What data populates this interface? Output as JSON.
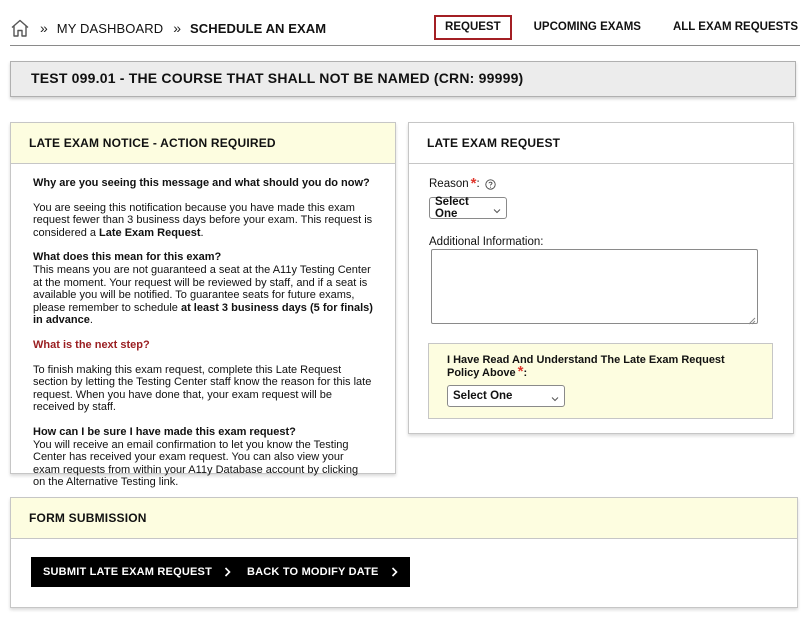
{
  "breadcrumb": {
    "sep": "»",
    "items": [
      "MY DASHBOARD",
      "SCHEDULE AN EXAM"
    ]
  },
  "nav": {
    "tabs": [
      {
        "label": "REQUEST",
        "active": true
      },
      {
        "label": "UPCOMING EXAMS",
        "active": false
      },
      {
        "label": "ALL EXAM REQUESTS",
        "active": false
      }
    ]
  },
  "course": {
    "title": "TEST 099.01 - THE COURSE THAT SHALL NOT BE NAMED (CRN: 99999)"
  },
  "notice": {
    "title": "LATE EXAM NOTICE - ACTION REQUIRED",
    "q1": "Why are you seeing this message and what should you do now?",
    "p1_text": "You are seeing this notification because you have made this exam request fewer than 3 business days before your exam. This request is considered a ",
    "p1_bold": "Late Exam Request",
    "p1_end": ".",
    "q2": "What does this mean for this exam?",
    "p2_text": "This means you are not guaranteed a seat at the A11y Testing Center at the moment. Your request will be reviewed by staff, and if a seat is available you will be notified. To guarantee seats for future exams, please remember to schedule ",
    "p2_bold": "at least 3 business days (5 for finals) in advance",
    "p2_end": ".",
    "q3": "What is the next step?",
    "p3": "To finish making this exam request, complete this Late Request section by letting the Testing Center staff know the reason for this late request. When you have done that, your exam request will be received by staff.",
    "q4": "How can I be sure I have made this exam request?",
    "p4": "You will receive an email confirmation to let you know the Testing Center has received your exam request. You can also view your exam requests from within your A11y Database account by clicking on the Alternative Testing link."
  },
  "late_request": {
    "title": "LATE EXAM REQUEST",
    "reason_label": "Reason",
    "required_mark": "*",
    "colon": ":",
    "reason_value": "Select One",
    "additional_label": "Additional Information:",
    "additional_value": "",
    "policy_label": "I Have Read And Understand The Late Exam Request Policy Above",
    "policy_value": "Select One"
  },
  "form_submission": {
    "title": "FORM SUBMISSION",
    "submit_label": "SUBMIT LATE EXAM REQUEST",
    "back_label": "BACK TO MODIFY DATE"
  },
  "colors": {
    "accent_red": "#a31f24",
    "required_star": "#e0372d",
    "notice_bg": "#fdfde0"
  },
  "icons": {
    "home": "home-icon",
    "help": "help-circle-icon",
    "dropdown": "chevron-down-icon",
    "button_arrow": "chevron-right-icon"
  }
}
